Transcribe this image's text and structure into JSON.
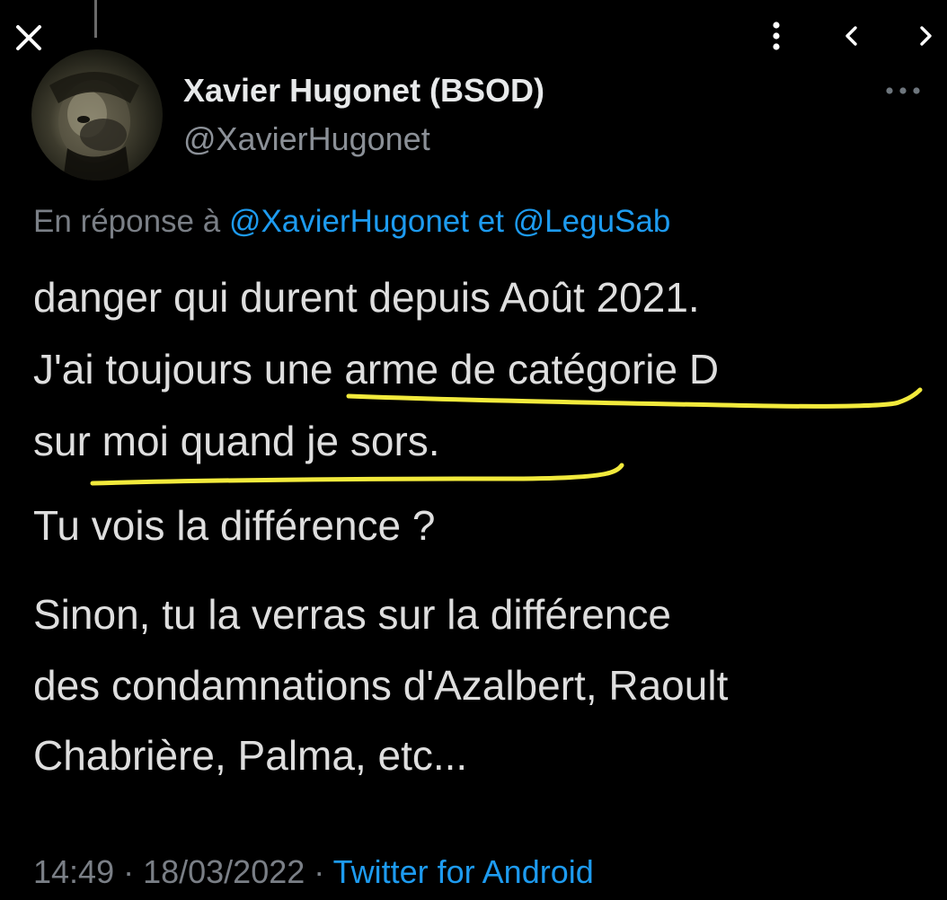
{
  "header": {
    "close_icon": "close-icon",
    "menu_icon": "kebab-vertical-icon",
    "prev_icon": "chevron-left-icon",
    "next_icon": "chevron-right-icon"
  },
  "author": {
    "display_name": "Xavier Hugonet (BSOD)",
    "handle": "@XavierHugonet",
    "more_icon": "more-horizontal-icon"
  },
  "reply": {
    "prefix": "En réponse à ",
    "mention_1": "@XavierHugonet",
    "conjunction": " et ",
    "mention_2": "@LeguSab"
  },
  "tweet": {
    "lines": [
      "danger qui durent depuis Août 2021.",
      "J'ai toujours une arme de catégorie D",
      "sur moi quand je sors.",
      "Tu vois la différence ?",
      "Sinon, tu la verras sur la différence",
      "des condamnations d'Azalbert, Raoult",
      "Chabrière, Palma, etc..."
    ]
  },
  "meta": {
    "time": "14:49",
    "separator_1": " · ",
    "date": "18/03/2022",
    "separator_2": " · ",
    "source": "Twitter for Android"
  },
  "colors": {
    "background": "#000000",
    "text": "#dedede",
    "muted": "#7a7f86",
    "link": "#1d9bf0",
    "highlight_underline": "#f2ea3c"
  }
}
